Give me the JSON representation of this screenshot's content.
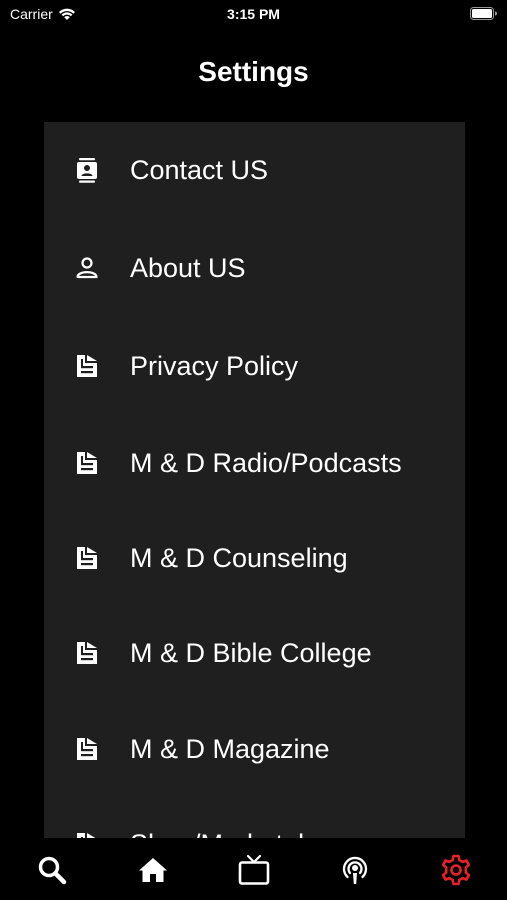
{
  "status_bar": {
    "carrier": "Carrier",
    "time": "3:15 PM"
  },
  "header": {
    "title": "Settings"
  },
  "settings": {
    "items": [
      {
        "label": "Contact US",
        "icon": "contact-card-icon"
      },
      {
        "label": "About US",
        "icon": "person-icon"
      },
      {
        "label": "Privacy Policy",
        "icon": "document-icon"
      },
      {
        "label": "M & D Radio/Podcasts",
        "icon": "document-icon"
      },
      {
        "label": "M & D Counseling",
        "icon": "document-icon"
      },
      {
        "label": "M & D Bible College",
        "icon": "document-icon"
      },
      {
        "label": "M & D Magazine",
        "icon": "document-icon"
      },
      {
        "label": "Shop/Marketplace",
        "icon": "document-icon"
      }
    ]
  },
  "tab_bar": {
    "tabs": [
      {
        "icon": "search-icon",
        "active": false
      },
      {
        "icon": "home-icon",
        "active": false
      },
      {
        "icon": "tv-icon",
        "active": false
      },
      {
        "icon": "podcast-icon",
        "active": false
      },
      {
        "icon": "gear-icon",
        "active": true
      }
    ],
    "active_color": "#e8202a",
    "inactive_color": "#ffffff"
  },
  "colors": {
    "background": "#000000",
    "panel": "#1f1f1f",
    "text": "#ffffff"
  }
}
